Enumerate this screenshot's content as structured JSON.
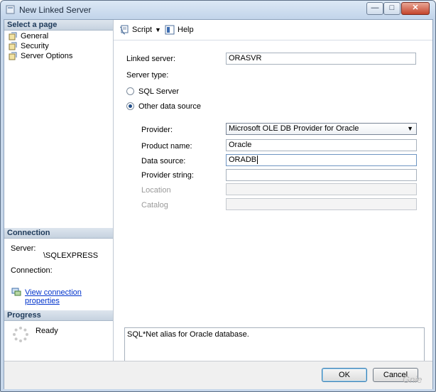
{
  "window": {
    "title": "New Linked Server",
    "min_glyph": "—",
    "max_glyph": "□",
    "close_glyph": "✕"
  },
  "left": {
    "select_page_header": "Select a page",
    "pages": [
      {
        "label": "General",
        "icon": "page-icon"
      },
      {
        "label": "Security",
        "icon": "page-icon"
      },
      {
        "label": "Server Options",
        "icon": "page-icon"
      }
    ],
    "connection_header": "Connection",
    "server_label": "Server:",
    "server_value": "\\SQLEXPRESS",
    "connection_label": "Connection:",
    "view_properties_link": "View connection properties",
    "progress_header": "Progress",
    "progress_status": "Ready"
  },
  "toolbar": {
    "script_label": "Script",
    "help_label": "Help"
  },
  "form": {
    "linked_server_label": "Linked server:",
    "linked_server_value": "ORASVR",
    "server_type_label": "Server type:",
    "sql_server_option": "SQL Server",
    "other_source_option": "Other data source",
    "provider_label": "Provider:",
    "provider_value": "Microsoft OLE DB Provider for Oracle",
    "product_name_label": "Product name:",
    "product_name_value": "Oracle",
    "data_source_label": "Data source:",
    "data_source_value": "ORADB",
    "provider_string_label": "Provider string:",
    "provider_string_value": "",
    "location_label": "Location",
    "catalog_label": "Catalog",
    "description": "SQL*Net alias for Oracle database."
  },
  "buttons": {
    "ok": "OK",
    "cancel": "Cancel"
  },
  "watermark": "Gnie",
  "colors": {
    "accent": "#1f4c88",
    "link": "#0033cc",
    "header_bg": "#c6d2df",
    "close_red": "#c4442c"
  }
}
